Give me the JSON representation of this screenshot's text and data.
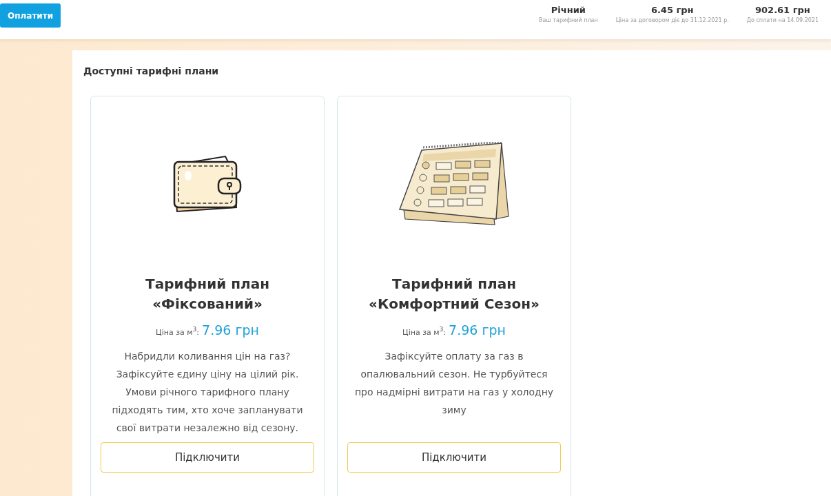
{
  "header": {
    "pay_button": "Оплатити",
    "stats": [
      {
        "value": "Річний",
        "caption": "Ваш тарифний план"
      },
      {
        "value": "6.45 грн",
        "caption": "Ціна за договором діє до 31.12.2021 р."
      },
      {
        "value": "902.61 грн",
        "caption": "До сплати на 14.09.2021"
      }
    ]
  },
  "section_title": "Доступні тарифні плани",
  "plans": [
    {
      "kind": "wallet",
      "title": "Тарифний план\n«Фіксований»",
      "price_label": "Ціна за м$^{3}$:",
      "price": "7.96 грн",
      "description": "Набридли коливання цін на газ? Зафіксуйте єдину ціну на цілий рік. Умови річного тарифного плану підходять тим, хто хоче запланувати свої витрати незалежно від сезону.",
      "button": "Підключити"
    },
    {
      "kind": "calendar",
      "title": "Тарифний план\n«Комфортний Сезон»",
      "price_label": "Ціна за м$^{3}$:",
      "price": "7.96 грн",
      "description": "Зафіксуйте оплату за газ в опалювальний сезон. Не турбуйтеся про надмірні витрати на газ у холодну зиму",
      "button": "Підключити"
    }
  ]
}
